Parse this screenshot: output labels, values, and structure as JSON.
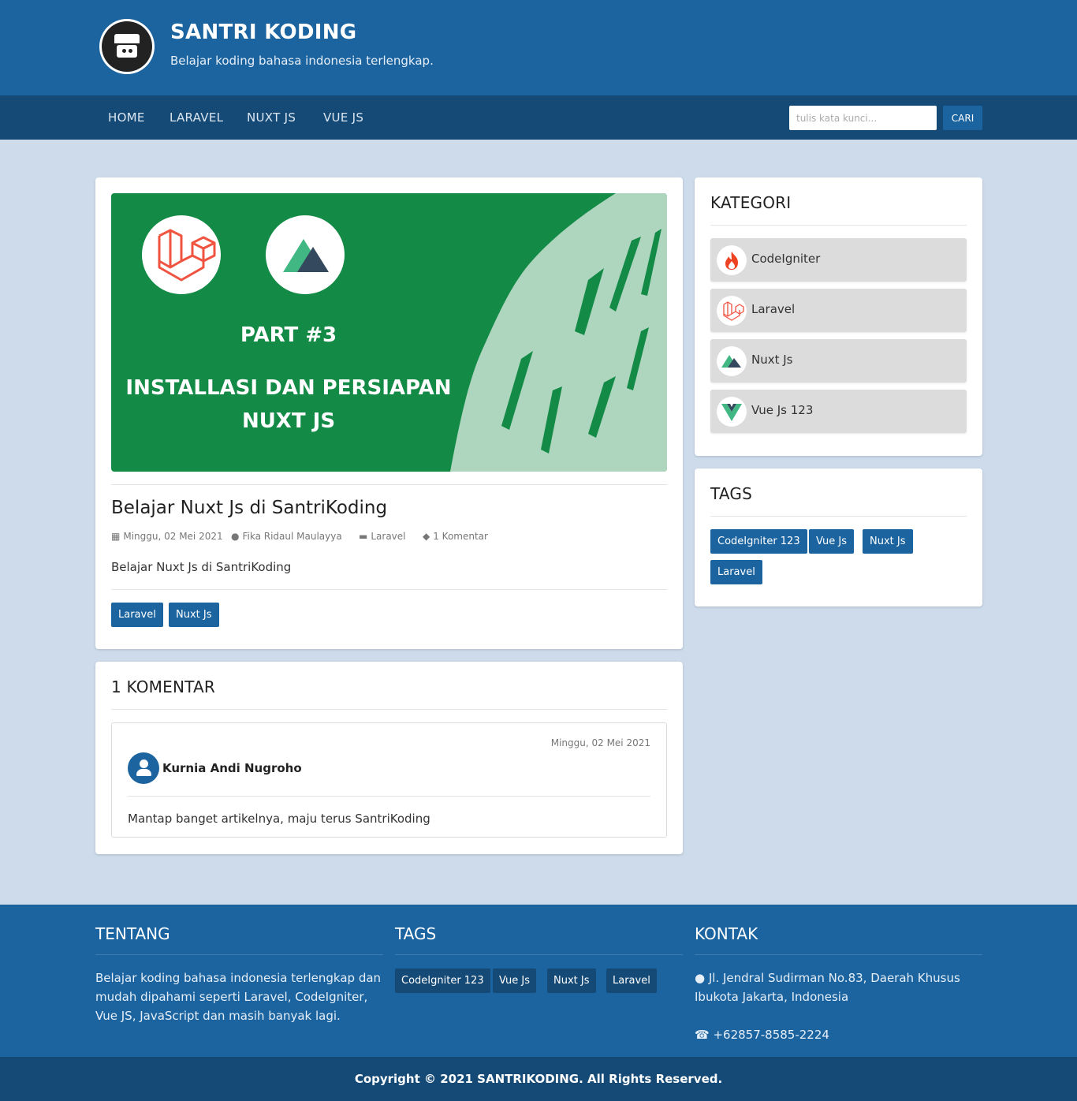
{
  "header": {
    "site_title": "SANTRI KODING",
    "tagline": "Belajar koding bahasa indonesia terlengkap."
  },
  "nav": {
    "items": [
      "HOME",
      "LARAVEL",
      "NUXT JS",
      "VUE JS"
    ],
    "search_placeholder": "tulis kata kunci...",
    "search_button": "CARI"
  },
  "post": {
    "hero": {
      "part": "PART #3",
      "line1": "INSTALLASI DAN PERSIAPAN",
      "line2": "NUXT JS",
      "colors": {
        "green": "#138a45",
        "mint": "#aed6bf"
      }
    },
    "title": "Belajar Nuxt Js di SantriKoding",
    "date": "Minggu, 02 Mei 2021",
    "author": "Fika Ridaul Maulayya",
    "category": "Laravel",
    "comments_count": "1 Komentar",
    "excerpt": "Belajar Nuxt Js di SantriKoding",
    "tags": [
      "Laravel",
      "Nuxt Js"
    ]
  },
  "comments": {
    "title": "1 KOMENTAR",
    "items": [
      {
        "date": "Minggu, 02 Mei 2021",
        "author": "Kurnia Andi Nugroho",
        "text": "Mantap banget artikelnya, maju terus SantriKoding"
      }
    ]
  },
  "sidebar": {
    "kategori_title": "KATEGORI",
    "kategori": [
      {
        "label": "CodeIgniter",
        "icon": "codeigniter-icon"
      },
      {
        "label": "Laravel",
        "icon": "laravel-icon"
      },
      {
        "label": "Nuxt Js",
        "icon": "nuxt-icon"
      },
      {
        "label": "Vue Js 123",
        "icon": "vue-icon"
      }
    ],
    "tags_title": "TAGS",
    "tags": [
      "CodeIgniter 123",
      "Vue Js",
      "Nuxt Js",
      "Laravel"
    ]
  },
  "footer": {
    "tentang_title": "TENTANG",
    "tentang_line1": "Belajar koding bahasa indonesia terlengkap dan",
    "tentang_line2": "mudah dipahami seperti Laravel, CodeIgniter,",
    "tentang_line3": "Vue JS, JavaScript dan masih banyak lagi.",
    "tags_title": "TAGS",
    "tags": [
      "CodeIgniter 123",
      "Vue Js",
      "Nuxt Js",
      "Laravel"
    ],
    "kontak_title": "KONTAK",
    "address_line1": "Jl. Jendral Sudirman No.83, Daerah Khusus",
    "address_line2": "Ibukota Jakarta, Indonesia",
    "phone": "+62857-8585-2224",
    "copyright": "Copyright © 2021 SANTRIKODING. All Rights Reserved."
  },
  "colors": {
    "primary": "#1b64a0",
    "primary_dark": "#154a77",
    "page_bg": "#cddbeb"
  }
}
